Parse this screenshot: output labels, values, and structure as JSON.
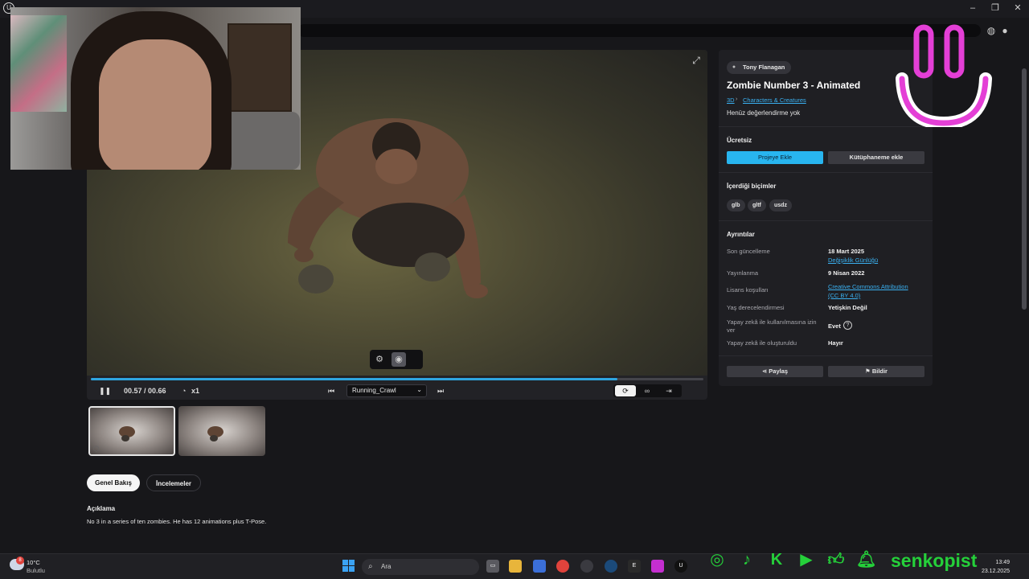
{
  "colors": {
    "accent": "#28b5ef",
    "link": "#3ab0f0",
    "overlay_green": "#25d03a",
    "overlay_pink": "#e43fd6"
  },
  "viewer": {
    "time": "00.57 / 00.66",
    "speed": "x1",
    "animation": "Running_Crawl",
    "progress_fraction": 0.86
  },
  "tabs": [
    {
      "label": "Genel Bakış",
      "active": true
    },
    {
      "label": "İncelemeler",
      "active": false
    }
  ],
  "description": {
    "title": "Açıklama",
    "text": "No 3 in a series of ten zombies. He has 12 animations plus T-Pose."
  },
  "side": {
    "author": "Tony Flanagan",
    "title": "Zombie Number 3 - Animated",
    "breadcrumb": [
      "3D",
      "Characters & Creatures"
    ],
    "rating": "Henüz değerlendirme yok",
    "price": "Ücretsiz",
    "add_to_project": "Projeye Ekle",
    "add_to_library": "Kütüphaneme ekle",
    "formats_title": "İçerdiği biçimler",
    "formats": [
      "glb",
      "gltf",
      "usdz"
    ],
    "details_title": "Ayrıntılar",
    "details": {
      "last_update_label": "Son güncelleme",
      "last_update_value": "18 Mart 2025",
      "changelog": "Değişiklik Günlüğü",
      "published_label": "Yayınlanma",
      "published_value": "9 Nisan 2022",
      "license_label": "Lisans koşulları",
      "license_value_1": "Creative Commons Attribution",
      "license_value_2": "(CC BY 4.0)",
      "age_label": "Yaş derecelendirmesi",
      "age_value": "Yetişkin Değil",
      "ai_use_label_1": "Yapay zekâ ile kullanılmasına izin",
      "ai_use_label_2": "ver",
      "ai_use_value": "Evet",
      "ai_made_label": "Yapay zekâ ile oluşturuldu",
      "ai_made_value": "Hayır"
    },
    "share": "Paylaş",
    "report": "Bildir"
  },
  "overlay": {
    "channel": "senkopist"
  },
  "taskbar": {
    "weather_badge": "8",
    "temp": "10°C",
    "condition": "Bulutlu",
    "search_placeholder": "Ara",
    "time": "13:49",
    "date": "23.12.2025"
  }
}
